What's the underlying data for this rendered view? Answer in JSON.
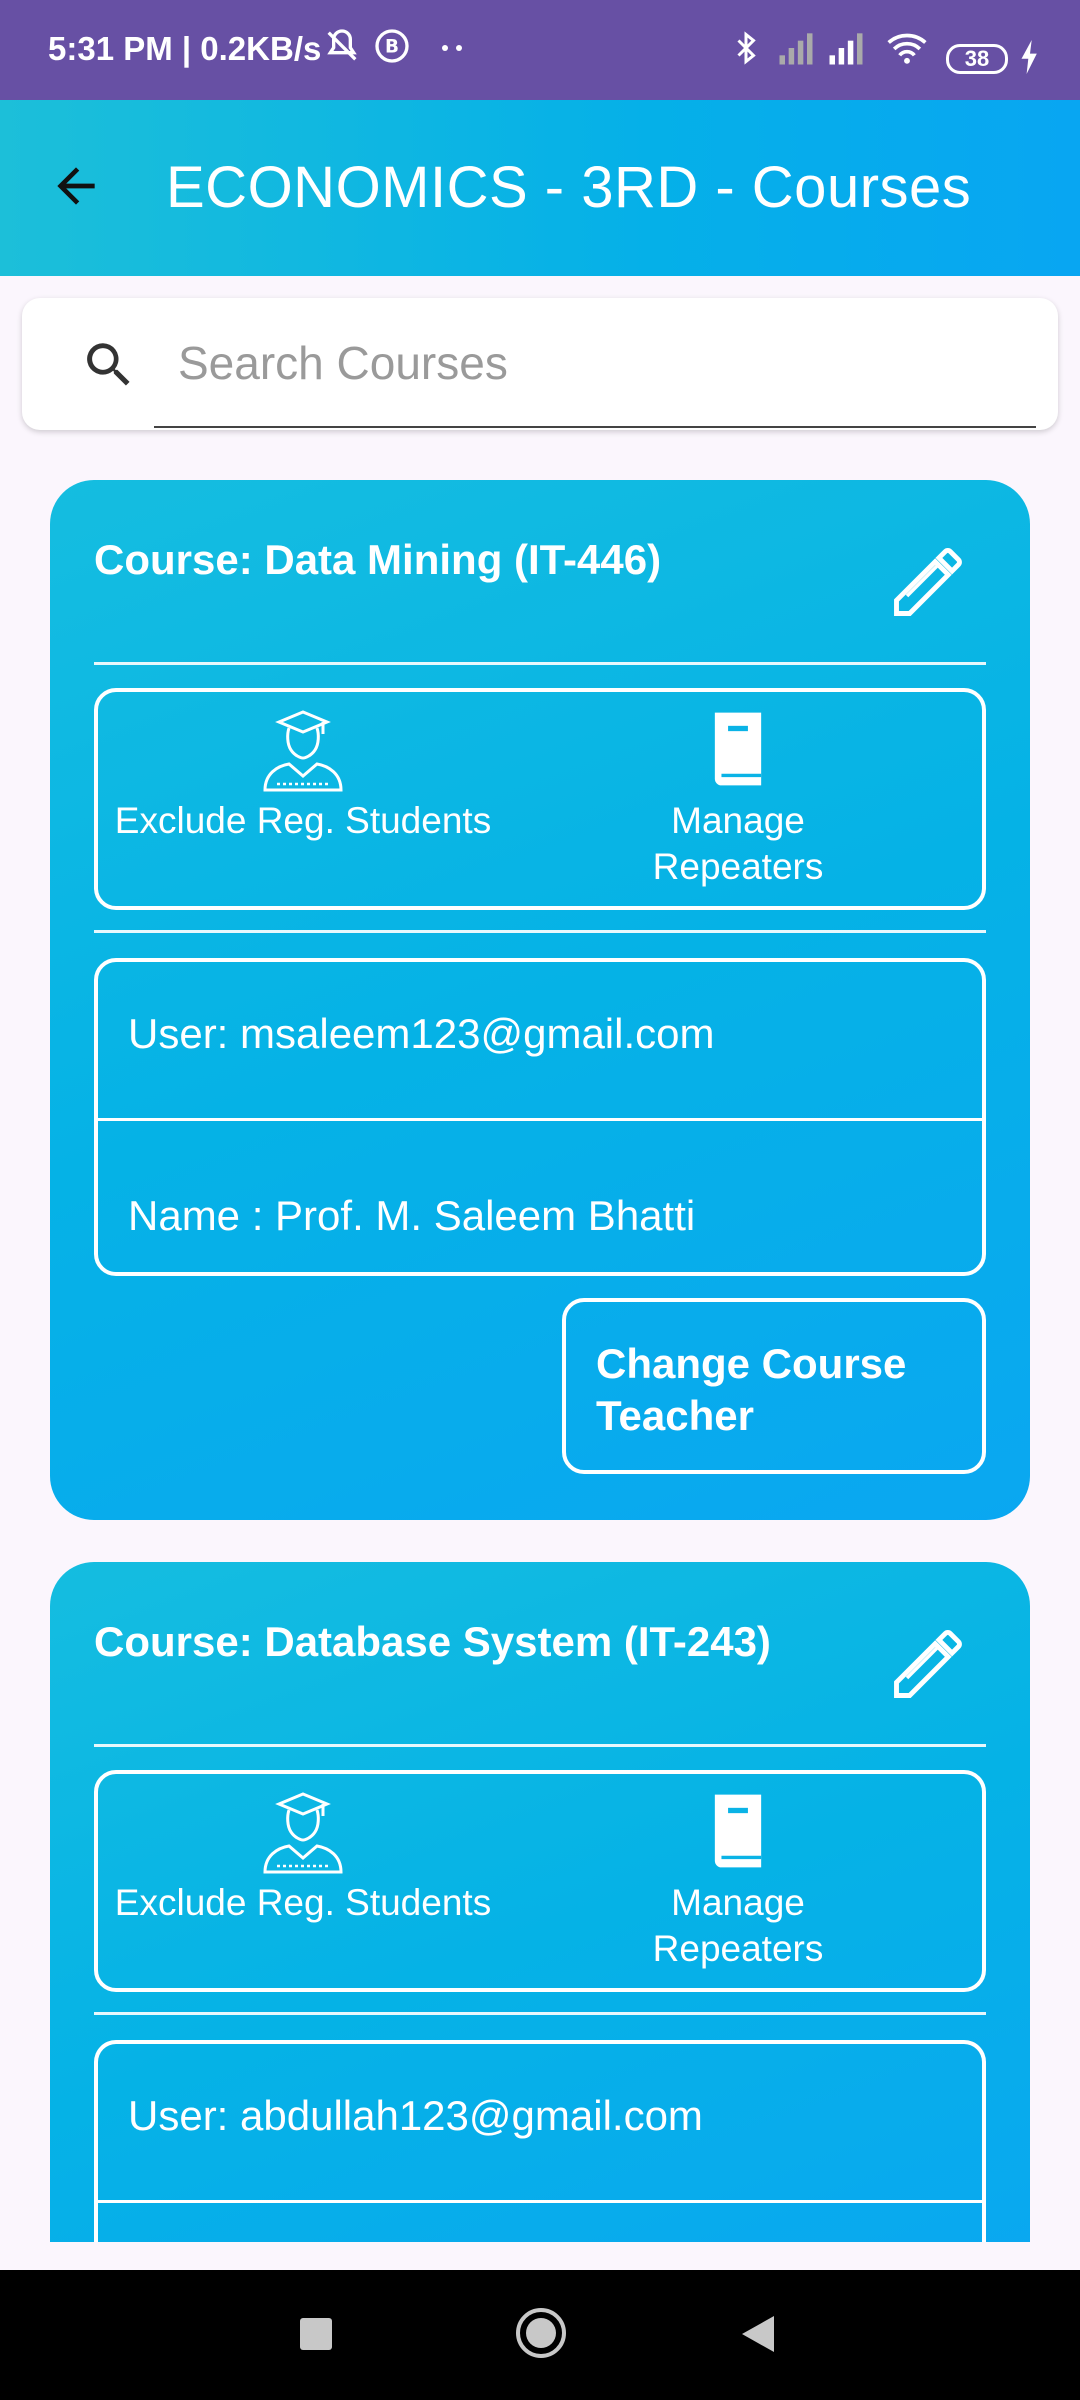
{
  "status_bar": {
    "time": "5:31 PM | 0.2KB/s",
    "battery": "38"
  },
  "app_bar": {
    "title": "ECONOMICS - 3RD - Courses"
  },
  "search": {
    "placeholder": "Search Courses",
    "value": ""
  },
  "courses": [
    {
      "title": "Course: Data Mining (IT-446)",
      "exclude_label": "Exclude Reg. Students",
      "repeaters_label_1": "Manage",
      "repeaters_label_2": "Repeaters",
      "user": "User: msaleem123@gmail.com",
      "name": "Name : Prof. M. Saleem Bhatti",
      "change_teacher_1": "Change Course",
      "change_teacher_2": "Teacher"
    },
    {
      "title": "Course: Database System (IT-243)",
      "exclude_label": "Exclude Reg. Students",
      "repeaters_label_1": "Manage",
      "repeaters_label_2": "Repeaters",
      "user": "User: abdullah123@gmail.com"
    }
  ],
  "icons": {
    "back": "arrow-left-icon",
    "search": "search-icon",
    "edit": "pencil-icon",
    "student": "student-graduate-icon",
    "book": "book-icon"
  },
  "colors": {
    "status_bar": "#6750a4",
    "app_bar": "#08b4e6",
    "card": "#05b2e6"
  }
}
